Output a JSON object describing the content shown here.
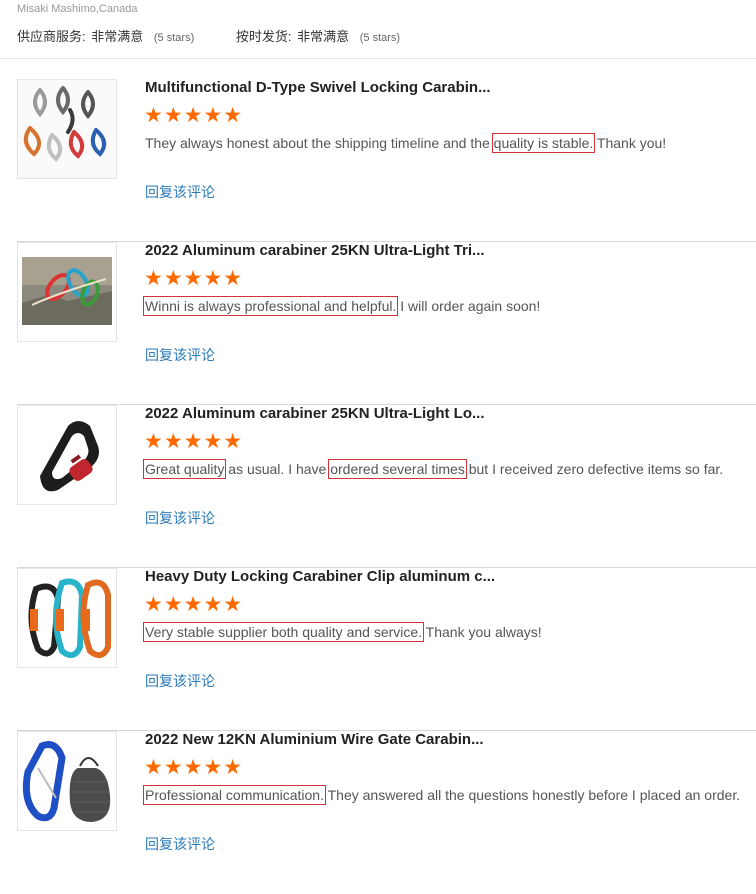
{
  "header": {
    "reviewer": "Misaki Mashimo,Canada",
    "ratings": [
      {
        "label": "供应商服务:",
        "value": "非常满意",
        "stars": "(5 stars)"
      },
      {
        "label": "按时发货:",
        "value": "非常满意",
        "stars": "(5 stars)"
      }
    ]
  },
  "colors": {
    "accent_star": "#ff6a00",
    "link": "#2a7ab8",
    "highlight_box": "#d0343a"
  },
  "reviews": [
    {
      "title": "Multifunctional D-Type Swivel Locking Carabin...",
      "stars": "★★★★★",
      "rating": 5,
      "comment": {
        "a": "They always honest about the shipping timeline and the ",
        "b": "quality is stable.",
        "c": " Thank you!"
      },
      "reply": "回复该评论"
    },
    {
      "title": "2022 Aluminum carabiner 25KN Ultra-Light Tri...",
      "stars": "★★★★★",
      "rating": 5,
      "comment": {
        "a": "Winni is always professional and helpful.",
        "b": " I will order again soon!"
      },
      "reply": "回复该评论"
    },
    {
      "title": "2022 Aluminum carabiner 25KN Ultra-Light Lo...",
      "stars": "★★★★★",
      "rating": 5,
      "comment": {
        "a": "Great quality",
        "b": " as usual. I have ",
        "c": "ordered several times",
        "d": " but I received zero defective items so far."
      },
      "reply": "回复该评论"
    },
    {
      "title": "Heavy Duty Locking Carabiner Clip aluminum c...",
      "stars": "★★★★★",
      "rating": 5,
      "comment": {
        "a": "Very stable supplier both quality and service.",
        "b": " Thank you always!"
      },
      "reply": "回复该评论"
    },
    {
      "title": "2022 New 12KN Aluminium Wire Gate Carabin...",
      "stars": "★★★★★",
      "rating": 5,
      "comment": {
        "a": "Professional communication.",
        "b": " They answered all the questions honestly before I placed an order."
      },
      "reply": "回复该评论"
    }
  ]
}
